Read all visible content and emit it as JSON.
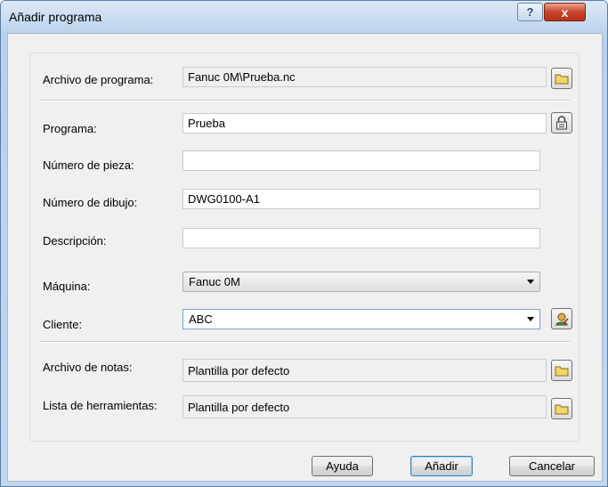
{
  "window": {
    "title": "Añadir programa",
    "help_glyph": "?",
    "close_glyph": "x"
  },
  "fields": {
    "archivo_programa": {
      "label": "Archivo de programa:",
      "value": "Fanuc 0M\\Prueba.nc"
    },
    "programa": {
      "label": "Programa:",
      "value": "Prueba"
    },
    "numero_pieza": {
      "label": "Número de pieza:",
      "value": ""
    },
    "numero_dibujo": {
      "label": "Número de dibujo:",
      "value": "DWG0100-A1"
    },
    "descripcion": {
      "label": "Descripción:",
      "value": ""
    },
    "maquina": {
      "label": "Máquina:",
      "value": "Fanuc 0M"
    },
    "cliente": {
      "label": "Cliente:",
      "value": "ABC"
    },
    "archivo_notas": {
      "label": "Archivo de notas:",
      "value": "Plantilla por defecto"
    },
    "lista_herramientas": {
      "label": "Lista de herramientas:",
      "value": "Plantilla por defecto"
    }
  },
  "buttons": {
    "help": "Ayuda",
    "add": "Añadir",
    "cancel": "Cancelar"
  },
  "icons": {
    "browse": "folder-icon",
    "lock": "lock-icon",
    "customer": "customer-icon"
  },
  "colors": {
    "titlebar": "#bcd3ec",
    "dialog_bg": "#f0f0f0",
    "close": "#c8442c",
    "folder": "#f2d46a"
  }
}
